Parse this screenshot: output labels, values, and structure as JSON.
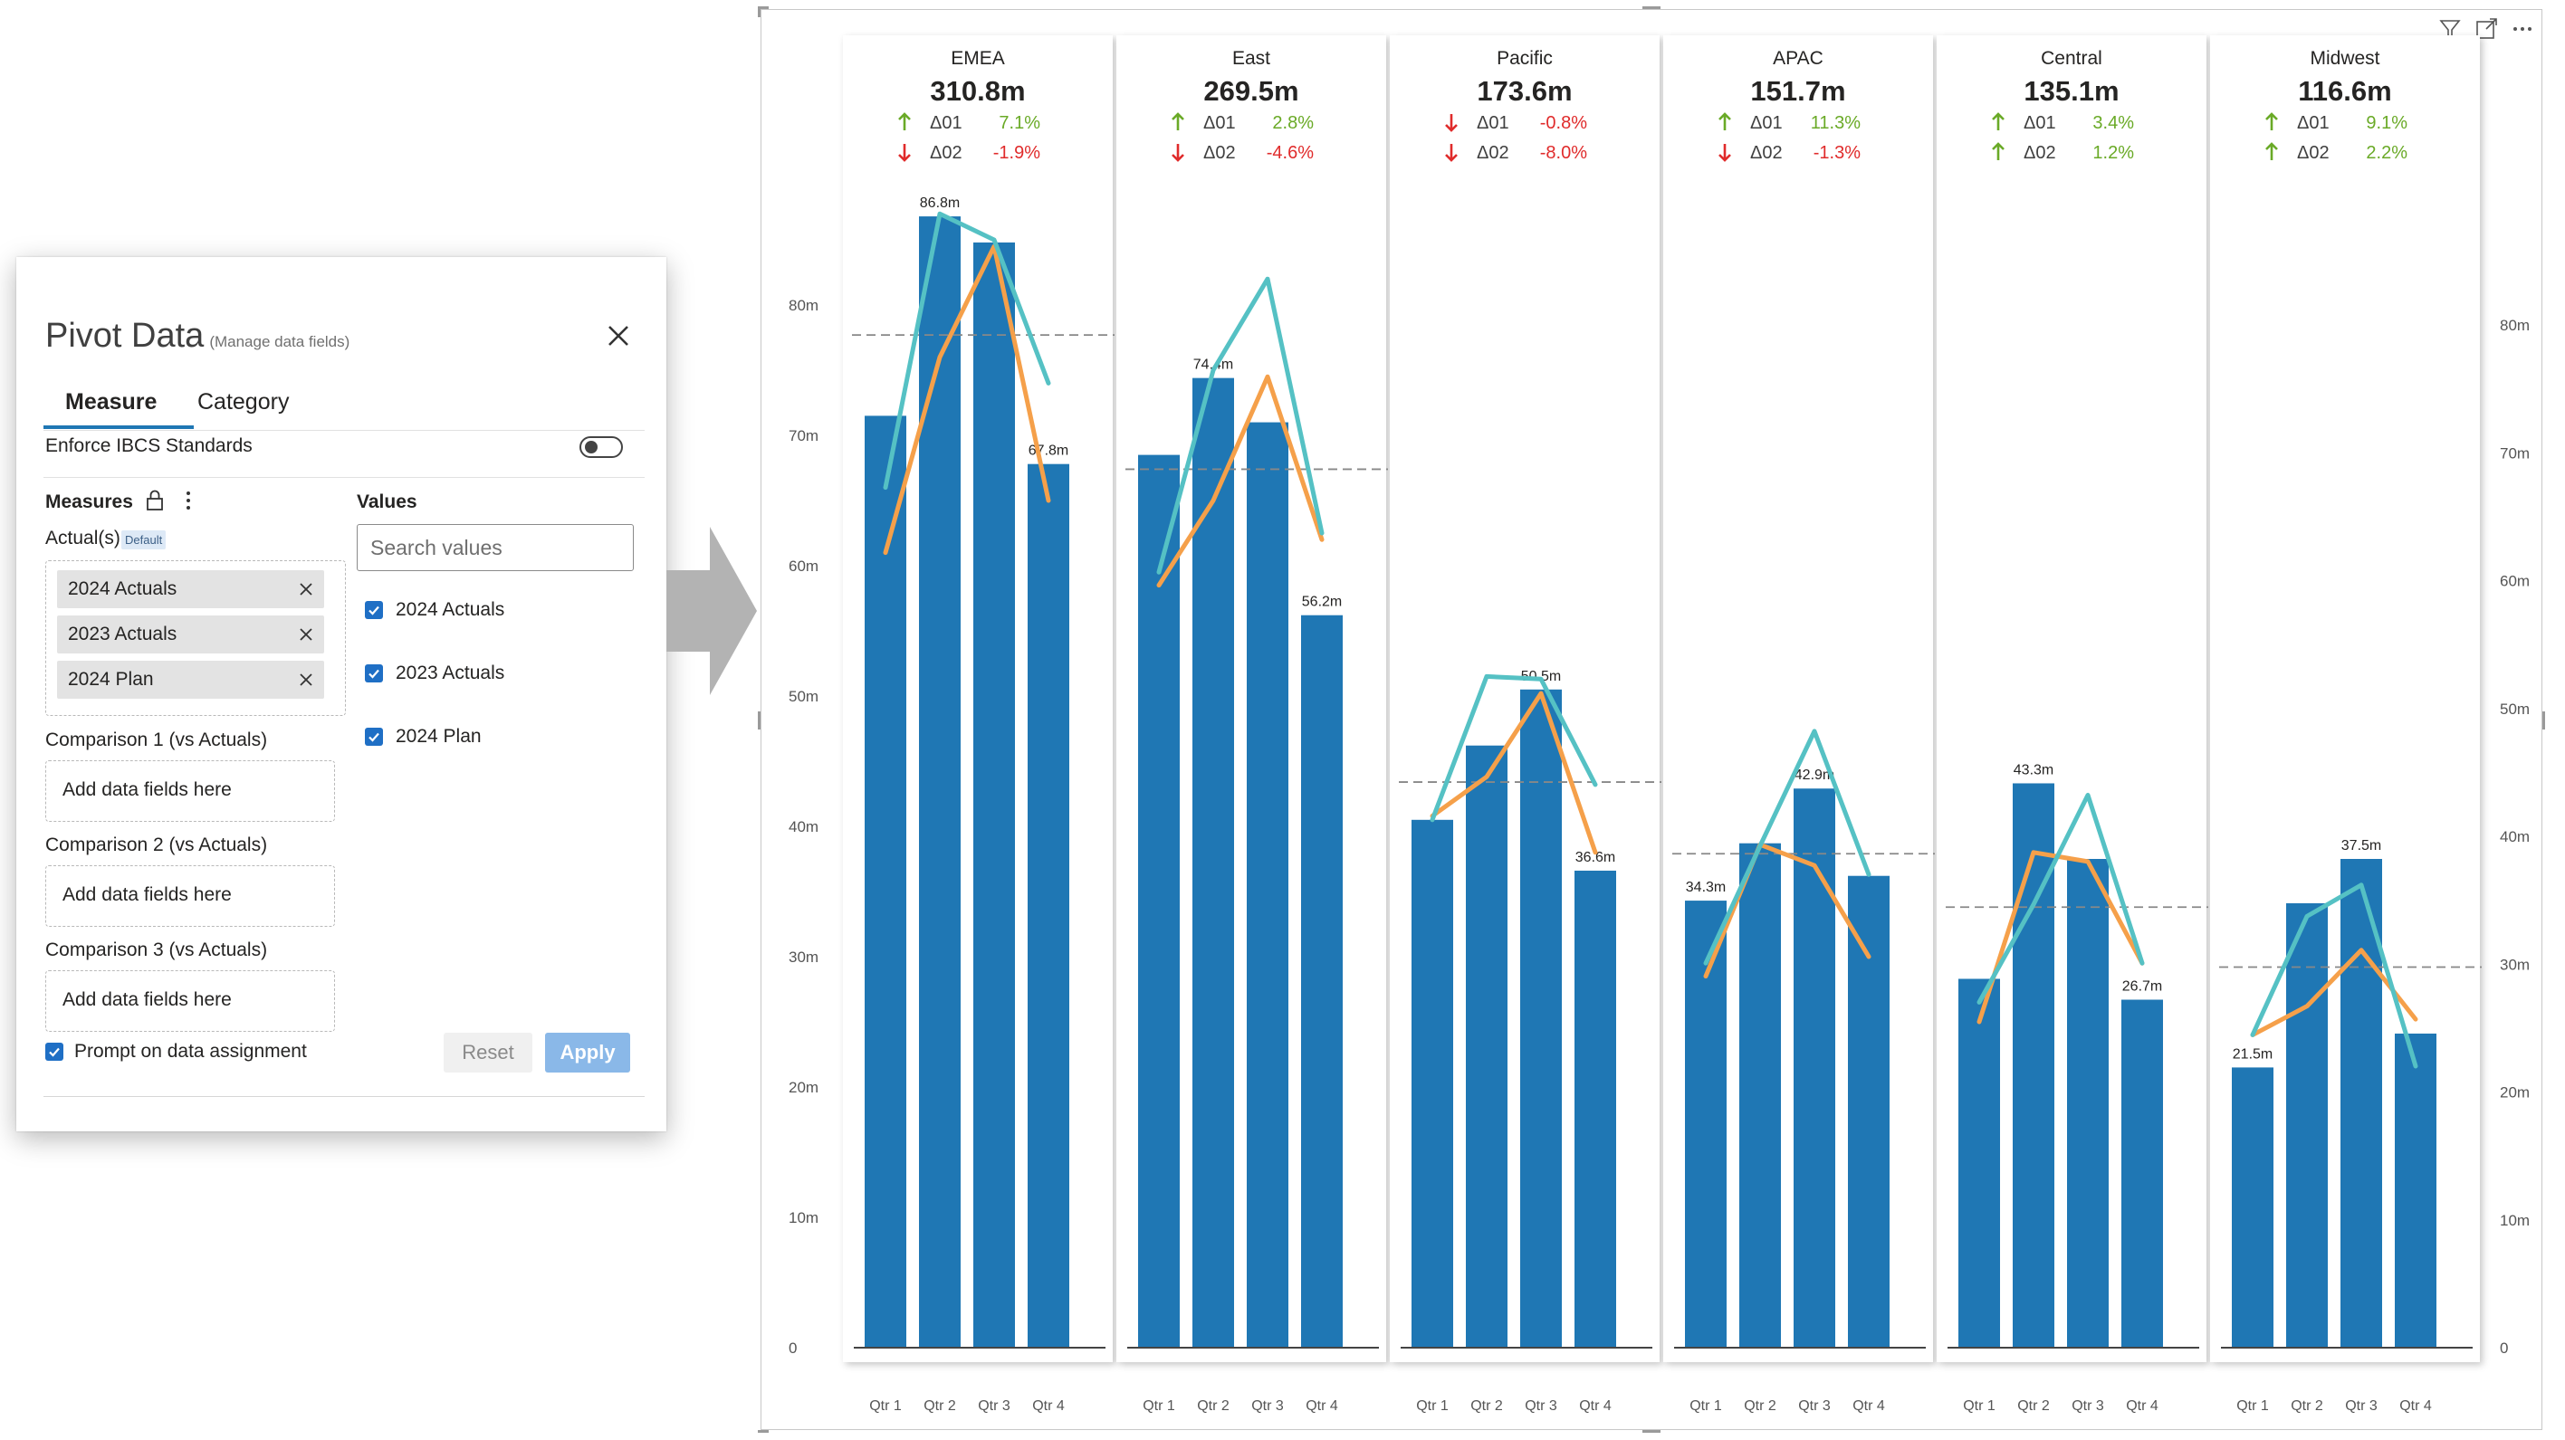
{
  "dialog": {
    "title": "Pivot Data",
    "subtitle": "(Manage data fields)",
    "tabs": [
      {
        "label": "Measure",
        "active": true
      },
      {
        "label": "Category",
        "active": false
      }
    ],
    "enforce_label": "Enforce IBCS Standards",
    "measures_label": "Measures",
    "actuals_label": "Actual(s)",
    "default_badge": "Default",
    "actual_fields": [
      "2024 Actuals",
      "2023 Actuals",
      "2024 Plan"
    ],
    "comparisons": [
      {
        "label": "Comparison 1 (vs Actuals)",
        "placeholder": "Add data fields here"
      },
      {
        "label": "Comparison 2 (vs Actuals)",
        "placeholder": "Add data fields here"
      },
      {
        "label": "Comparison 3 (vs Actuals)",
        "placeholder": "Add data fields here"
      }
    ],
    "values_label": "Values",
    "search_placeholder": "Search values",
    "value_options": [
      {
        "label": "2024 Actuals",
        "checked": true
      },
      {
        "label": "2023 Actuals",
        "checked": true
      },
      {
        "label": "2024 Plan",
        "checked": true
      }
    ],
    "prompt_label": "Prompt on data assignment",
    "reset_label": "Reset",
    "apply_label": "Apply"
  },
  "icons": {
    "visual": [
      "filter-icon",
      "focus-mode-icon",
      "more-options-icon"
    ],
    "dialog": [
      "close-icon",
      "lock-icon",
      "more-vertical-icon",
      "chip-remove-icon",
      "checkbox-checked-icon",
      "arrow-right-icon"
    ]
  },
  "colors": {
    "bar": "#1f77b4",
    "line_2023": "#55c1c4",
    "line_plan": "#f5a04a",
    "positive": "#6aaa27",
    "negative": "#e02b2b",
    "apply_button": "#8ab8e8",
    "checkbox": "#1f6fc5"
  },
  "chart_data": {
    "type": "bar",
    "categories": [
      "Qtr 1",
      "Qtr 2",
      "Qtr 3",
      "Qtr 4"
    ],
    "y_ticks": [
      "0",
      "10m",
      "20m",
      "30m",
      "40m",
      "50m",
      "60m",
      "70m",
      "80m"
    ],
    "ylim": [
      0,
      100
    ],
    "grid": false,
    "panels": [
      {
        "region": "EMEA",
        "total": "310.8m",
        "d1": "7.1%",
        "d2": "-1.9%",
        "d1_up": true,
        "d2_up": false,
        "actuals": [
          71.5,
          86.8,
          84.8,
          67.8
        ],
        "prior": [
          66,
          87,
          85,
          74
        ],
        "plan": [
          61,
          76,
          84.5,
          65
        ],
        "avg": 77.7,
        "labels": [
          "",
          "86.8m",
          "",
          "67.8m"
        ]
      },
      {
        "region": "East",
        "total": "269.5m",
        "d1": "2.8%",
        "d2": "-4.6%",
        "d1_up": true,
        "d2_up": false,
        "actuals": [
          68.5,
          74.4,
          71,
          56.2
        ],
        "prior": [
          59.5,
          75,
          82,
          62.5
        ],
        "plan": [
          58.5,
          65,
          74.5,
          62
        ],
        "avg": 67.4,
        "labels": [
          "",
          "74.4m",
          "",
          "56.2m"
        ]
      },
      {
        "region": "Pacific",
        "total": "173.6m",
        "d1": "-0.8%",
        "d2": "-8.0%",
        "d1_up": false,
        "d2_up": false,
        "actuals": [
          40.5,
          46.2,
          50.5,
          36.6
        ],
        "prior": [
          40.5,
          51.5,
          51.3,
          43.2
        ],
        "plan": [
          40.8,
          43.8,
          50.2,
          38
        ],
        "avg": 43.4,
        "labels": [
          "",
          "",
          "50.5m",
          "36.6m"
        ]
      },
      {
        "region": "APAC",
        "total": "151.7m",
        "d1": "11.3%",
        "d2": "-1.3%",
        "d1_up": true,
        "d2_up": false,
        "actuals": [
          34.3,
          38.7,
          42.9,
          36.2
        ],
        "prior": [
          29.5,
          38.5,
          47.3,
          36.3
        ],
        "plan": [
          28.5,
          38.6,
          37,
          30
        ],
        "avg": 37.9,
        "labels": [
          "34.3m",
          "",
          "42.9m",
          ""
        ]
      },
      {
        "region": "Central",
        "total": "135.1m",
        "d1": "3.4%",
        "d2": "1.2%",
        "d1_up": true,
        "d2_up": true,
        "actuals": [
          28.3,
          43.3,
          37.5,
          26.7
        ],
        "prior": [
          26.5,
          34,
          42.4,
          29.5
        ],
        "plan": [
          25,
          38,
          37.3,
          29.5
        ],
        "avg": 33.8,
        "labels": [
          "",
          "43.3m",
          "",
          "26.7m"
        ]
      },
      {
        "region": "Midwest",
        "total": "116.6m",
        "d1": "9.1%",
        "d2": "2.2%",
        "d1_up": true,
        "d2_up": true,
        "actuals": [
          21.5,
          34.1,
          37.5,
          24.1
        ],
        "prior": [
          24,
          33.1,
          35.5,
          21.6
        ],
        "plan": [
          24,
          26.2,
          30.5,
          25.2
        ],
        "avg": 29.2,
        "labels": [
          "21.5m",
          "",
          "37.5m",
          ""
        ]
      }
    ],
    "delta_labels": [
      "Δ01",
      "Δ02"
    ]
  }
}
